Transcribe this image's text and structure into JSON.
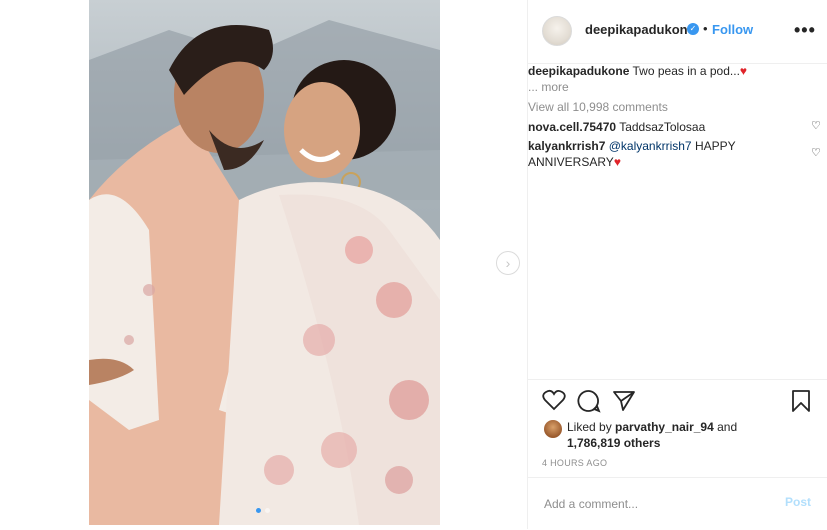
{
  "header": {
    "username": "deepikapadukone",
    "bullet": "•",
    "follow_label": "Follow",
    "more_label": "•••"
  },
  "caption": {
    "username": "deepikapadukone",
    "text": "Two peas in a pod...",
    "emoji": "♥",
    "more_label": "... more"
  },
  "view_all_comments": "View all 10,998 comments",
  "comments": [
    {
      "username": "nova.cell.75470",
      "text": "TaddsazTolosaa"
    },
    {
      "username": "kalyankrrish7",
      "mention": "@kalyankrrish7",
      "text": "HAPPY ANNIVERSARY",
      "emoji": "♥"
    }
  ],
  "likes": {
    "prefix": "Liked by",
    "user": "parvathy_nair_94",
    "and": "and",
    "count": "1,786,819 others"
  },
  "timestamp": "4 HOURS AGO",
  "comment_box": {
    "placeholder": "Add a comment...",
    "post_label": "Post"
  },
  "carousel": {
    "slides": 2,
    "active_index": 0
  },
  "colors": {
    "accent": "#3897f0",
    "heart": "#e0242a",
    "muted": "#8e8e8e"
  }
}
